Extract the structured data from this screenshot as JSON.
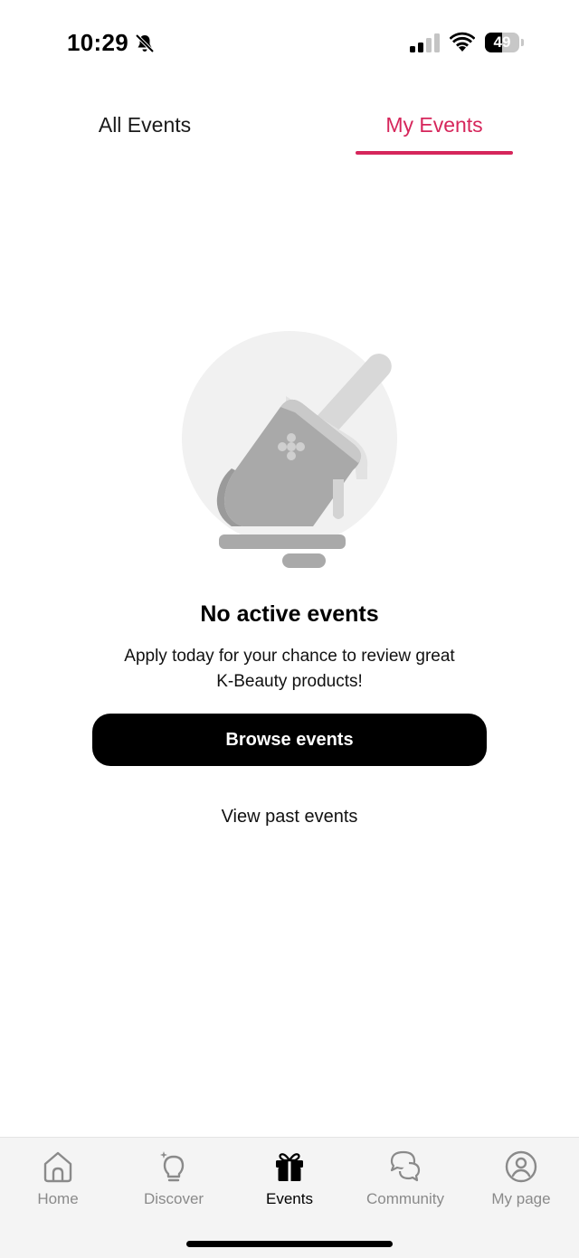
{
  "status_bar": {
    "time": "10:29",
    "battery": 49,
    "icons": [
      "bell-slash-icon",
      "signal-icon",
      "wifi-icon",
      "battery-icon"
    ]
  },
  "tabs": [
    {
      "label": "All Events",
      "active": false
    },
    {
      "label": "My Events",
      "active": true
    }
  ],
  "colors": {
    "accent": "#d6265b",
    "illustration_gray": "#a8a8a8",
    "illustration_light": "#d9d9d9",
    "nav_background": "#f4f4f4"
  },
  "empty_state": {
    "illustration": "paint-brush-illustration",
    "title": "No active events",
    "subtitle_line1": "Apply today for your chance to review great",
    "subtitle_line2": "K-Beauty products!",
    "primary_button": "Browse events",
    "secondary_link": "View past events"
  },
  "bottom_nav": [
    {
      "label": "Home",
      "icon": "home-icon",
      "active": false
    },
    {
      "label": "Discover",
      "icon": "lightbulb-icon",
      "active": false
    },
    {
      "label": "Events",
      "icon": "gift-icon",
      "active": true
    },
    {
      "label": "Community",
      "icon": "chat-bubbles-icon",
      "active": false
    },
    {
      "label": "My page",
      "icon": "user-circle-icon",
      "active": false
    }
  ]
}
